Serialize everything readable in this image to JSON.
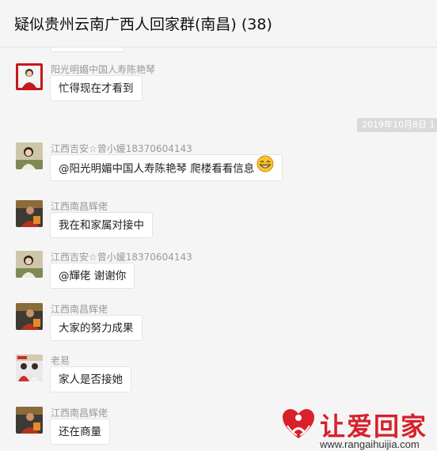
{
  "header": {
    "title": "疑似贵州云南广西人回家群(南昌) (38)"
  },
  "chat": {
    "timestamp": "2019年10月8日 1",
    "messages": [
      {
        "sender": "阳光明媚中国人寿陈艳琴",
        "text": "忙得现在才看到",
        "avatar": "avatar-red-woman"
      },
      {
        "sender": "江西吉安☆曾小媛18370604143",
        "text": "@阳光明媚中国人寿陈艳琴 爬楼看看信息",
        "avatar": "avatar-woman",
        "emoji": "grinning-emoji"
      },
      {
        "sender": "江西南昌辉佬",
        "text": "我在和家属对接中",
        "avatar": "avatar-man"
      },
      {
        "sender": "江西吉安☆曾小媛18370604143",
        "text": "@輝佬 谢谢你",
        "avatar": "avatar-woman"
      },
      {
        "sender": "江西南昌辉佬",
        "text": "大家的努力成果",
        "avatar": "avatar-man"
      },
      {
        "sender": "老易",
        "text": "家人是否接她",
        "avatar": "avatar-group"
      },
      {
        "sender": "江西南昌辉佬",
        "text": "还在商量",
        "avatar": "avatar-man"
      }
    ]
  },
  "watermark": {
    "text": "让爱回家",
    "url": "www.rangaihuijia.com"
  },
  "colors": {
    "brand_red": "#d8212b",
    "background": "#f5f5f5",
    "bubble": "#ffffff"
  }
}
